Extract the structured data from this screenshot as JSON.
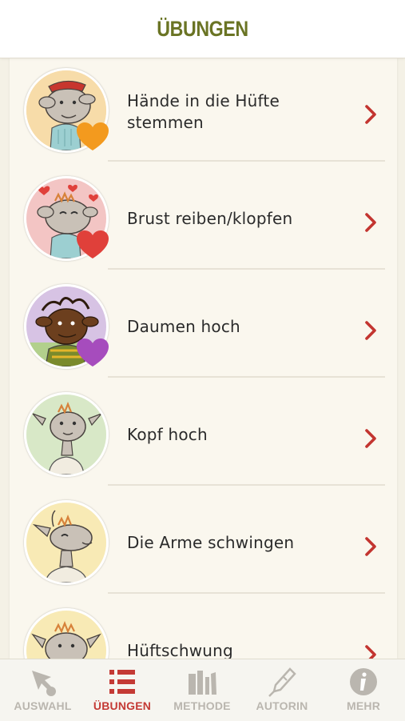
{
  "header": {
    "title": "ÜBUNGEN"
  },
  "exercises": [
    {
      "label_lines": [
        "Hände in die Hüfte",
        "stemmen"
      ],
      "heart": "orange-heart-icon",
      "heart_color": "#f39a1e",
      "avatar_bg": "#f7dca9"
    },
    {
      "label_lines": [
        "Brust reiben/klopfen"
      ],
      "heart": "red-heart-icon",
      "heart_color": "#e0403a",
      "avatar_bg": "#f3c5c4"
    },
    {
      "label_lines": [
        "Daumen hoch"
      ],
      "heart": "purple-heart-icon",
      "heart_color": "#a64cbd",
      "avatar_bg": "#d7c3e4"
    },
    {
      "label_lines": [
        "Kopf hoch"
      ],
      "heart": "",
      "heart_color": "",
      "avatar_bg": "#d8e8c7"
    },
    {
      "label_lines": [
        "Die Arme schwingen"
      ],
      "heart": "",
      "heart_color": "",
      "avatar_bg": "#f8eab5"
    },
    {
      "label_lines": [
        "Hüftschwung"
      ],
      "heart": "",
      "heart_color": "",
      "avatar_bg": "#f8eab5"
    }
  ],
  "tabs": [
    {
      "label": "AUSWAHL",
      "icon": "pointer-icon",
      "active": false
    },
    {
      "label": "ÜBUNGEN",
      "icon": "list-icon",
      "active": true
    },
    {
      "label": "METHODE",
      "icon": "books-icon",
      "active": false
    },
    {
      "label": "AUTORIN",
      "icon": "fountain-pen-icon",
      "active": false
    },
    {
      "label": "MEHR",
      "icon": "info-icon",
      "active": false
    }
  ],
  "colors": {
    "accent": "#c33530",
    "header_title": "#6a7424",
    "inactive_tab": "#b9b5ae",
    "background": "#faf7ee"
  }
}
